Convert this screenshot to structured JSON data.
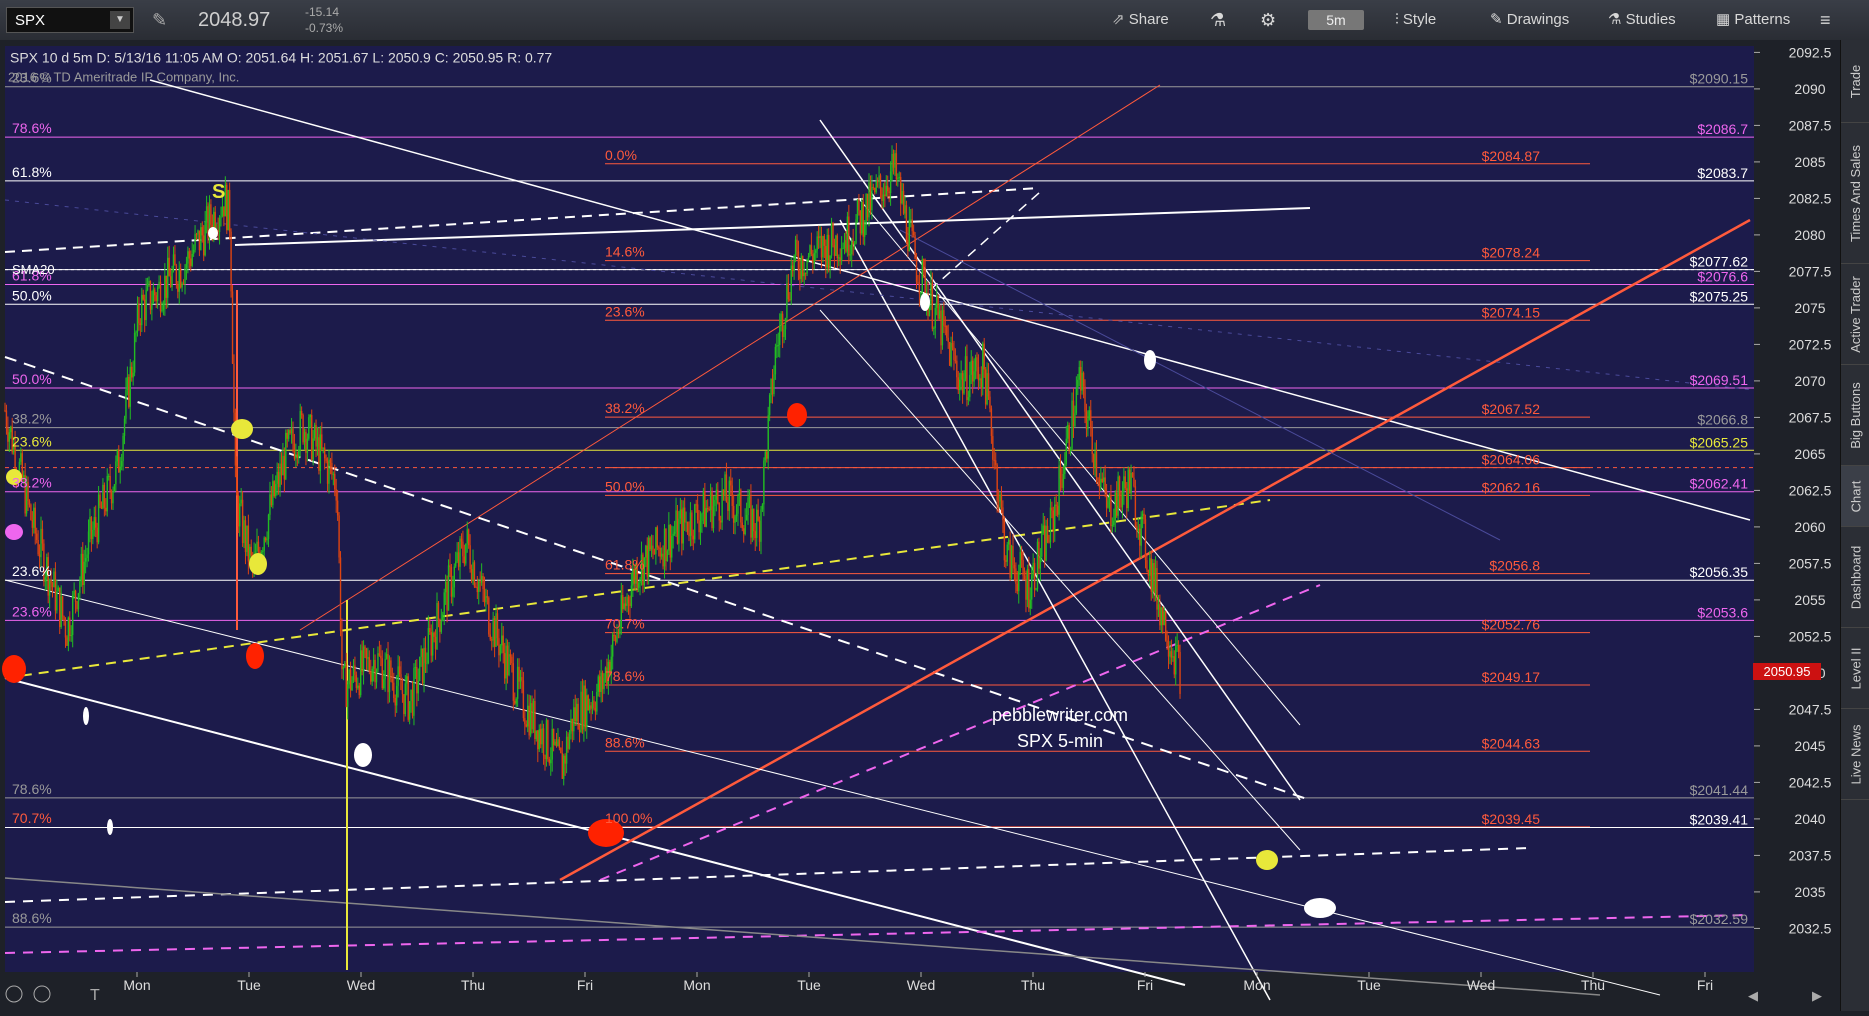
{
  "toolbar": {
    "symbol": "SPX",
    "price": "2048.97",
    "change": "-15.14",
    "change_pct": "-0.73%",
    "share": "Share",
    "timeframe": "5m",
    "style": "Style",
    "drawings": "Drawings",
    "studies": "Studies",
    "patterns": "Patterns"
  },
  "info_bar": "SPX 10 d 5m   D: 5/13/16 11:05 AM   O: 2051.64   H: 2051.67   L: 2050.9   C: 2050.95   R: 0.77",
  "copyright": "2016 © TD Ameritrade IP Company, Inc.",
  "watermark": [
    "pebblewriter.com",
    "SPX 5-min"
  ],
  "current_price": "2050.95",
  "sidebar_tabs": [
    "Trade",
    "Times And Sales",
    "Active Trader",
    "Big Buttons",
    "Chart",
    "Dashboard",
    "Level II",
    "Live News"
  ],
  "sma_label": "SMA20",
  "colors": {
    "background": "#1c1b4b",
    "up": "#22bb22",
    "down": "#dd4411",
    "fib": "#ff5a3c",
    "magenta": "#ee66ee",
    "yellow": "#e8e83a",
    "white": "#ffffff"
  },
  "chart_data": {
    "type": "candlestick",
    "instrument": "SPX",
    "interval": "5m",
    "ylim": [
      2031,
      2094
    ],
    "y_ticks": [
      2032.5,
      2035,
      2037.5,
      2040,
      2042.5,
      2045,
      2047.5,
      2050,
      2052.5,
      2055,
      2057.5,
      2060,
      2062.5,
      2065,
      2067.5,
      2070,
      2072.5,
      2075,
      2077.5,
      2080,
      2082.5,
      2085,
      2087.5,
      2090,
      2092.5
    ],
    "x_labels": [
      "Mon",
      "Tue",
      "Wed",
      "Thu",
      "Fri",
      "Mon",
      "Tue",
      "Wed",
      "Thu",
      "Fri",
      "Mon",
      "Tue",
      "Wed",
      "Thu",
      "Fri"
    ],
    "price_path": [
      [
        0,
        2068
      ],
      [
        0.25,
        2060
      ],
      [
        0.55,
        2053
      ],
      [
        0.75,
        2059
      ],
      [
        1.0,
        2064
      ],
      [
        1.2,
        2075
      ],
      [
        1.6,
        2078
      ],
      [
        1.95,
        2082.5
      ],
      [
        2.0,
        2081
      ],
      [
        2.05,
        2062
      ],
      [
        2.2,
        2057
      ],
      [
        2.5,
        2065
      ],
      [
        2.65,
        2067
      ],
      [
        2.95,
        2063
      ],
      [
        3.0,
        2049
      ],
      [
        3.3,
        2051
      ],
      [
        3.6,
        2048
      ],
      [
        3.95,
        2056
      ],
      [
        4.1,
        2059
      ],
      [
        4.3,
        2054
      ],
      [
        4.6,
        2048
      ],
      [
        4.95,
        2043.5
      ],
      [
        5.05,
        2047
      ],
      [
        5.3,
        2049
      ],
      [
        5.6,
        2057
      ],
      [
        6.0,
        2060
      ],
      [
        6.4,
        2062
      ],
      [
        6.7,
        2060
      ],
      [
        6.85,
        2072
      ],
      [
        7.0,
        2078
      ],
      [
        7.5,
        2080
      ],
      [
        7.9,
        2084.5
      ],
      [
        8.1,
        2078
      ],
      [
        8.5,
        2070
      ],
      [
        8.7,
        2071
      ],
      [
        8.9,
        2058
      ],
      [
        9.1,
        2056
      ],
      [
        9.3,
        2060
      ],
      [
        9.55,
        2070
      ],
      [
        9.8,
        2061
      ],
      [
        10.0,
        2063
      ],
      [
        10.25,
        2055
      ],
      [
        10.45,
        2050
      ]
    ],
    "series": [
      {
        "name": "SMA20",
        "values": [
          2077.62
        ]
      }
    ],
    "horizontal_levels": [
      {
        "label": "$2090.15",
        "value": 2090.15,
        "color": "#9a9a9a"
      },
      {
        "label": "$2086.7",
        "value": 2086.7,
        "color": "#ee66ee"
      },
      {
        "label": "$2084.87",
        "value": 2084.87,
        "color": "#ff5a3c"
      },
      {
        "label": "$2083.7",
        "value": 2083.7,
        "color": "#ffffff"
      },
      {
        "label": "$2078.24",
        "value": 2078.24,
        "color": "#ff5a3c"
      },
      {
        "label": "$2077.62",
        "value": 2077.62,
        "color": "#ffffff"
      },
      {
        "label": "$2076.6",
        "value": 2076.6,
        "color": "#ee66ee"
      },
      {
        "label": "$2075.25",
        "value": 2075.25,
        "color": "#ffffff"
      },
      {
        "label": "$2074.15",
        "value": 2074.15,
        "color": "#ff5a3c"
      },
      {
        "label": "$2069.51",
        "value": 2069.51,
        "color": "#ee66ee"
      },
      {
        "label": "$2067.52",
        "value": 2067.52,
        "color": "#ff5a3c"
      },
      {
        "label": "$2066.8",
        "value": 2066.8,
        "color": "#9a9a9a"
      },
      {
        "label": "$2065.25",
        "value": 2065.25,
        "color": "#e8e83a"
      },
      {
        "label": "$2064.06",
        "value": 2064.06,
        "color": "#ff5a3c"
      },
      {
        "label": "$2062.41",
        "value": 2062.41,
        "color": "#ee66ee"
      },
      {
        "label": "$2062.16",
        "value": 2062.16,
        "color": "#ff5a3c"
      },
      {
        "label": "$2056.8",
        "value": 2056.8,
        "color": "#ff5a3c"
      },
      {
        "label": "$2056.35",
        "value": 2056.35,
        "color": "#ffffff"
      },
      {
        "label": "$2053.6",
        "value": 2053.6,
        "color": "#ee66ee"
      },
      {
        "label": "$2052.76",
        "value": 2052.76,
        "color": "#ff5a3c"
      },
      {
        "label": "$2049.17",
        "value": 2049.17,
        "color": "#ff5a3c"
      },
      {
        "label": "$2044.63",
        "value": 2044.63,
        "color": "#ff5a3c"
      },
      {
        "label": "$2041.44",
        "value": 2041.44,
        "color": "#9a9a9a"
      },
      {
        "label": "$2039.45",
        "value": 2039.45,
        "color": "#ff5a3c"
      },
      {
        "label": "$2039.41",
        "value": 2039.41,
        "color": "#ffffff"
      },
      {
        "label": "$2032.59",
        "value": 2032.59,
        "color": "#9a9a9a"
      }
    ],
    "fib_labels_center": [
      {
        "label": "0.0%",
        "value": 2084.87
      },
      {
        "label": "14.6%",
        "value": 2078.24
      },
      {
        "label": "23.6%",
        "value": 2074.15
      },
      {
        "label": "38.2%",
        "value": 2067.52
      },
      {
        "label": "50.0%",
        "value": 2062.16
      },
      {
        "label": "61.8%",
        "value": 2056.8
      },
      {
        "label": "70.7%",
        "value": 2052.76
      },
      {
        "label": "78.6%",
        "value": 2049.17
      },
      {
        "label": "88.6%",
        "value": 2044.63
      },
      {
        "label": "100.0%",
        "value": 2039.45
      }
    ],
    "fib_labels_left": [
      {
        "label": "23.6%",
        "value": 2090.15,
        "color": "#9a9a9a"
      },
      {
        "label": "78.6%",
        "value": 2086.7,
        "color": "#ee66ee"
      },
      {
        "label": "61.8%",
        "value": 2083.7,
        "color": "#ffffff"
      },
      {
        "label": "61.8%",
        "value": 2076.6,
        "color": "#ee66ee"
      },
      {
        "label": "50.0%",
        "value": 2075.25,
        "color": "#ffffff"
      },
      {
        "label": "50.0%",
        "value": 2069.51,
        "color": "#ee66ee"
      },
      {
        "label": "38.2%",
        "value": 2066.8,
        "color": "#9a9a9a"
      },
      {
        "label": "23.6%",
        "value": 2065.25,
        "color": "#e8e83a"
      },
      {
        "label": "38.2%",
        "value": 2062.41,
        "color": "#ee66ee"
      },
      {
        "label": "23.6%",
        "value": 2056.35,
        "color": "#ffffff"
      },
      {
        "label": "23.6%",
        "value": 2053.6,
        "color": "#ee66ee"
      },
      {
        "label": "78.6%",
        "value": 2041.44,
        "color": "#9a9a9a"
      },
      {
        "label": "70.7%",
        "value": 2039.45,
        "color": "#ff5a3c"
      },
      {
        "label": "88.6%",
        "value": 2032.59,
        "color": "#9a9a9a"
      }
    ]
  }
}
